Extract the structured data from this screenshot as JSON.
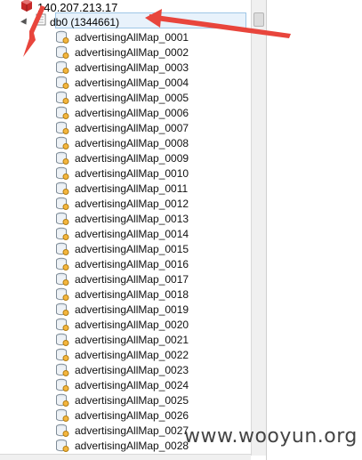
{
  "tree": {
    "server_label": "140.207.213.17",
    "database_label": "db0 (1344661)",
    "tables": [
      "advertisingAllMap_0001",
      "advertisingAllMap_0002",
      "advertisingAllMap_0003",
      "advertisingAllMap_0004",
      "advertisingAllMap_0005",
      "advertisingAllMap_0006",
      "advertisingAllMap_0007",
      "advertisingAllMap_0008",
      "advertisingAllMap_0009",
      "advertisingAllMap_0010",
      "advertisingAllMap_0011",
      "advertisingAllMap_0012",
      "advertisingAllMap_0013",
      "advertisingAllMap_0014",
      "advertisingAllMap_0015",
      "advertisingAllMap_0016",
      "advertisingAllMap_0017",
      "advertisingAllMap_0018",
      "advertisingAllMap_0019",
      "advertisingAllMap_0020",
      "advertisingAllMap_0021",
      "advertisingAllMap_0022",
      "advertisingAllMap_0023",
      "advertisingAllMap_0024",
      "advertisingAllMap_0025",
      "advertisingAllMap_0026",
      "advertisingAllMap_0027",
      "advertisingAllMap_0028"
    ]
  },
  "watermark": "www.wooyun.org",
  "colors": {
    "annotation_arrow": "#e8453c",
    "selection": "#e8f2fb",
    "server_icon": "#c62828"
  }
}
